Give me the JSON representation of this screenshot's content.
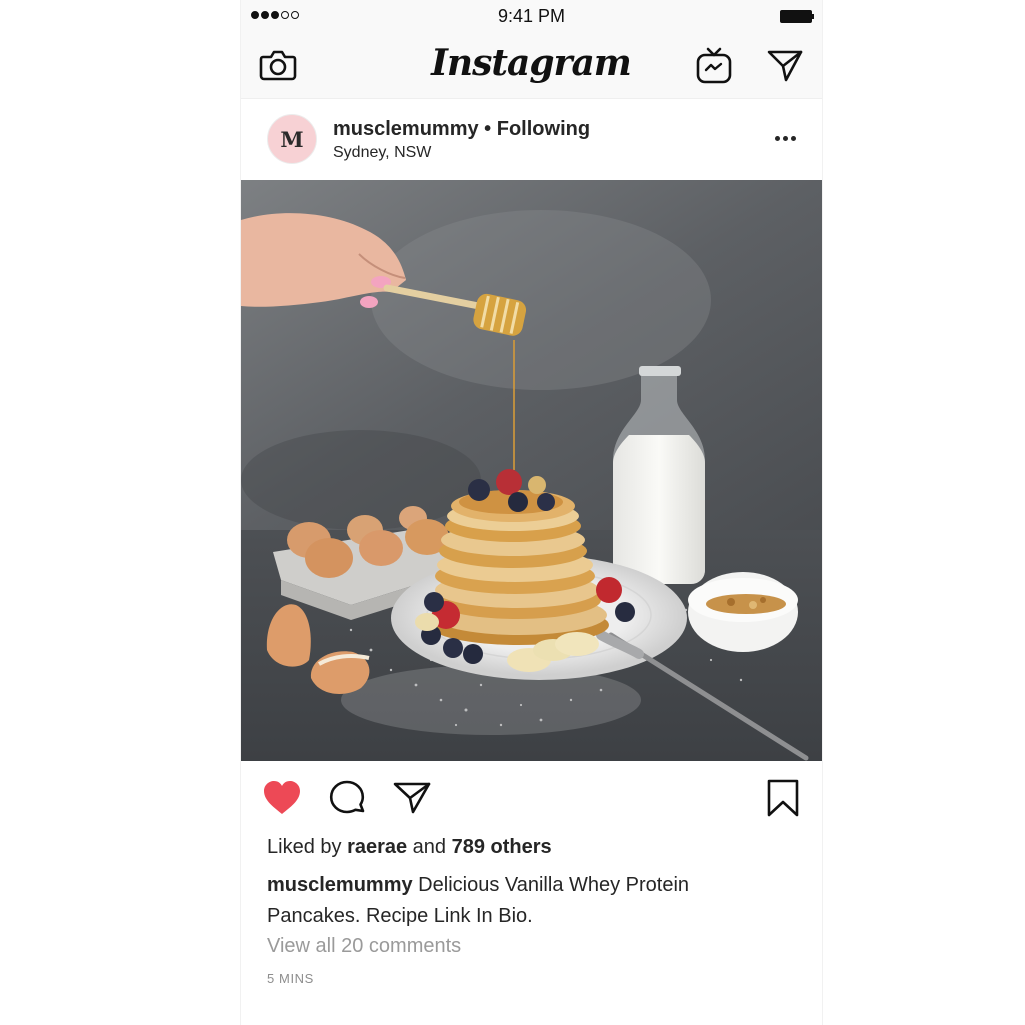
{
  "status_bar": {
    "time": "9:41 PM",
    "signal_bars_filled": 3,
    "signal_bars_total": 5
  },
  "header": {
    "brand": "Instagram",
    "icons": [
      "camera-icon",
      "igtv-icon",
      "direct-message-icon"
    ]
  },
  "post": {
    "avatar_initial": "M",
    "avatar_color": "#f7d1d4",
    "username": "musclemummy",
    "separator": " • ",
    "follow_status": "Following",
    "location": "Sydney, NSW",
    "more_icon": "more-options-icon",
    "actions": {
      "like_icon": "heart-icon",
      "liked": true,
      "like_color": "#ed4956",
      "comment_icon": "comment-icon",
      "share_icon": "share-icon",
      "save_icon": "bookmark-icon"
    },
    "likes": {
      "prefix": "Liked by ",
      "liker": "raerae",
      "middle": " and ",
      "others": "789 others"
    },
    "caption": {
      "username": "musclemummy",
      "text": " Delicious Vanilla Whey Protein Pancakes. Recipe Link In Bio."
    },
    "view_comments": "View all 20 comments",
    "timestamp": "5 MINS"
  }
}
